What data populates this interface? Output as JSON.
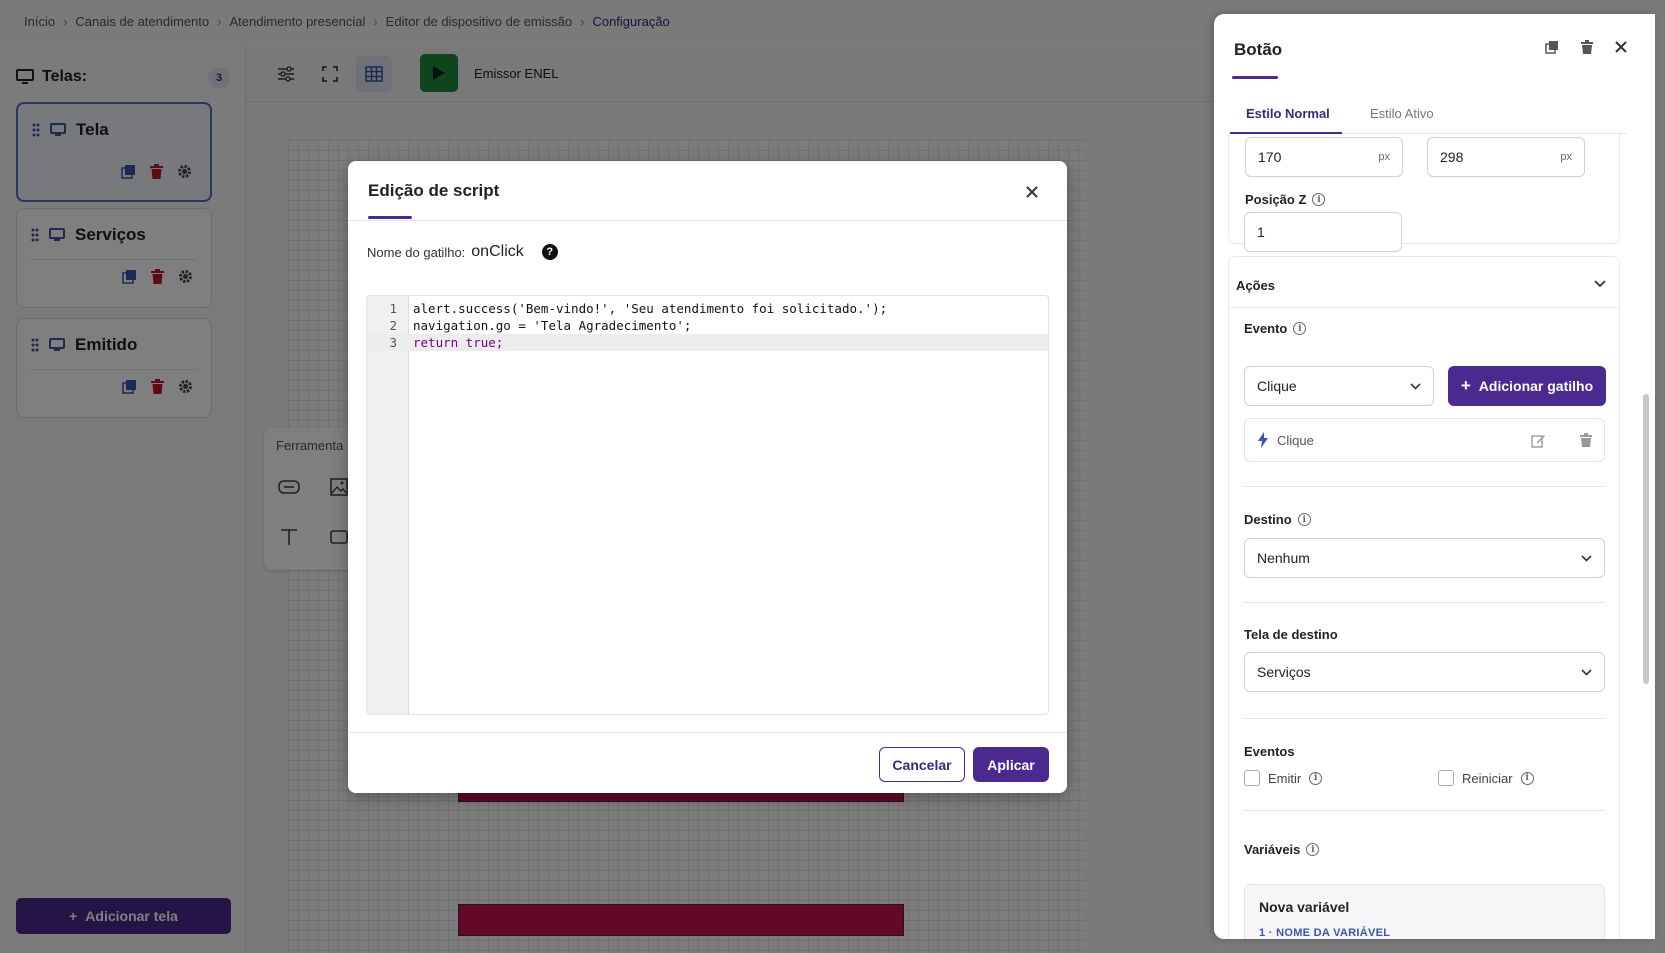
{
  "breadcrumb": {
    "items": [
      "Início",
      "Canais de atendimento",
      "Atendimento presencial",
      "Editor de dispositivo de emissão"
    ],
    "current": "Configuração"
  },
  "left_panel": {
    "title": "Telas:",
    "count": "3",
    "screens": [
      {
        "name": "Tela",
        "active": true
      },
      {
        "name": "Serviços",
        "active": false
      },
      {
        "name": "Emitido",
        "active": false
      }
    ],
    "add_label": "Adicionar tela"
  },
  "toolbar": {
    "device_label": "Emissor ENEL"
  },
  "tools": {
    "title": "Ferramenta"
  },
  "drawer": {
    "title": "Botão",
    "tabs": [
      "Estilo Normal",
      "Estilo Ativo"
    ],
    "position": {
      "x": "170",
      "y": "298",
      "unit": "px"
    },
    "z_label": "Posição Z",
    "z_value": "1",
    "actions_title": "Ações",
    "event_label": "Evento",
    "event_value": "Clique",
    "add_trigger_label": "Adicionar gatilho",
    "trigger_item": "Clique",
    "destination_label": "Destino",
    "destination_value": "Nenhum",
    "target_screen_label": "Tela de destino",
    "target_screen_value": "Serviços",
    "events_label": "Eventos",
    "emit_label": "Emitir",
    "restart_label": "Reiniciar",
    "variables_label": "Variáveis",
    "new_variable": "Nova variável",
    "variable_name_label": "1 · NOME DA VARIÁVEL"
  },
  "modal": {
    "title": "Edição de script",
    "trigger_label": "Nome do gatilho:",
    "trigger_value": "onClick",
    "code": [
      "alert.success('Bem-vindo!', 'Seu atendimento foi solicitado.');",
      "navigation.go = 'Tela Agradecimento';",
      "return true;"
    ],
    "cancel_label": "Cancelar",
    "apply_label": "Aplicar"
  },
  "colors": {
    "primary": "#4b2a8f",
    "play": "#1e8a3c",
    "canvas_button": "#c41250"
  }
}
